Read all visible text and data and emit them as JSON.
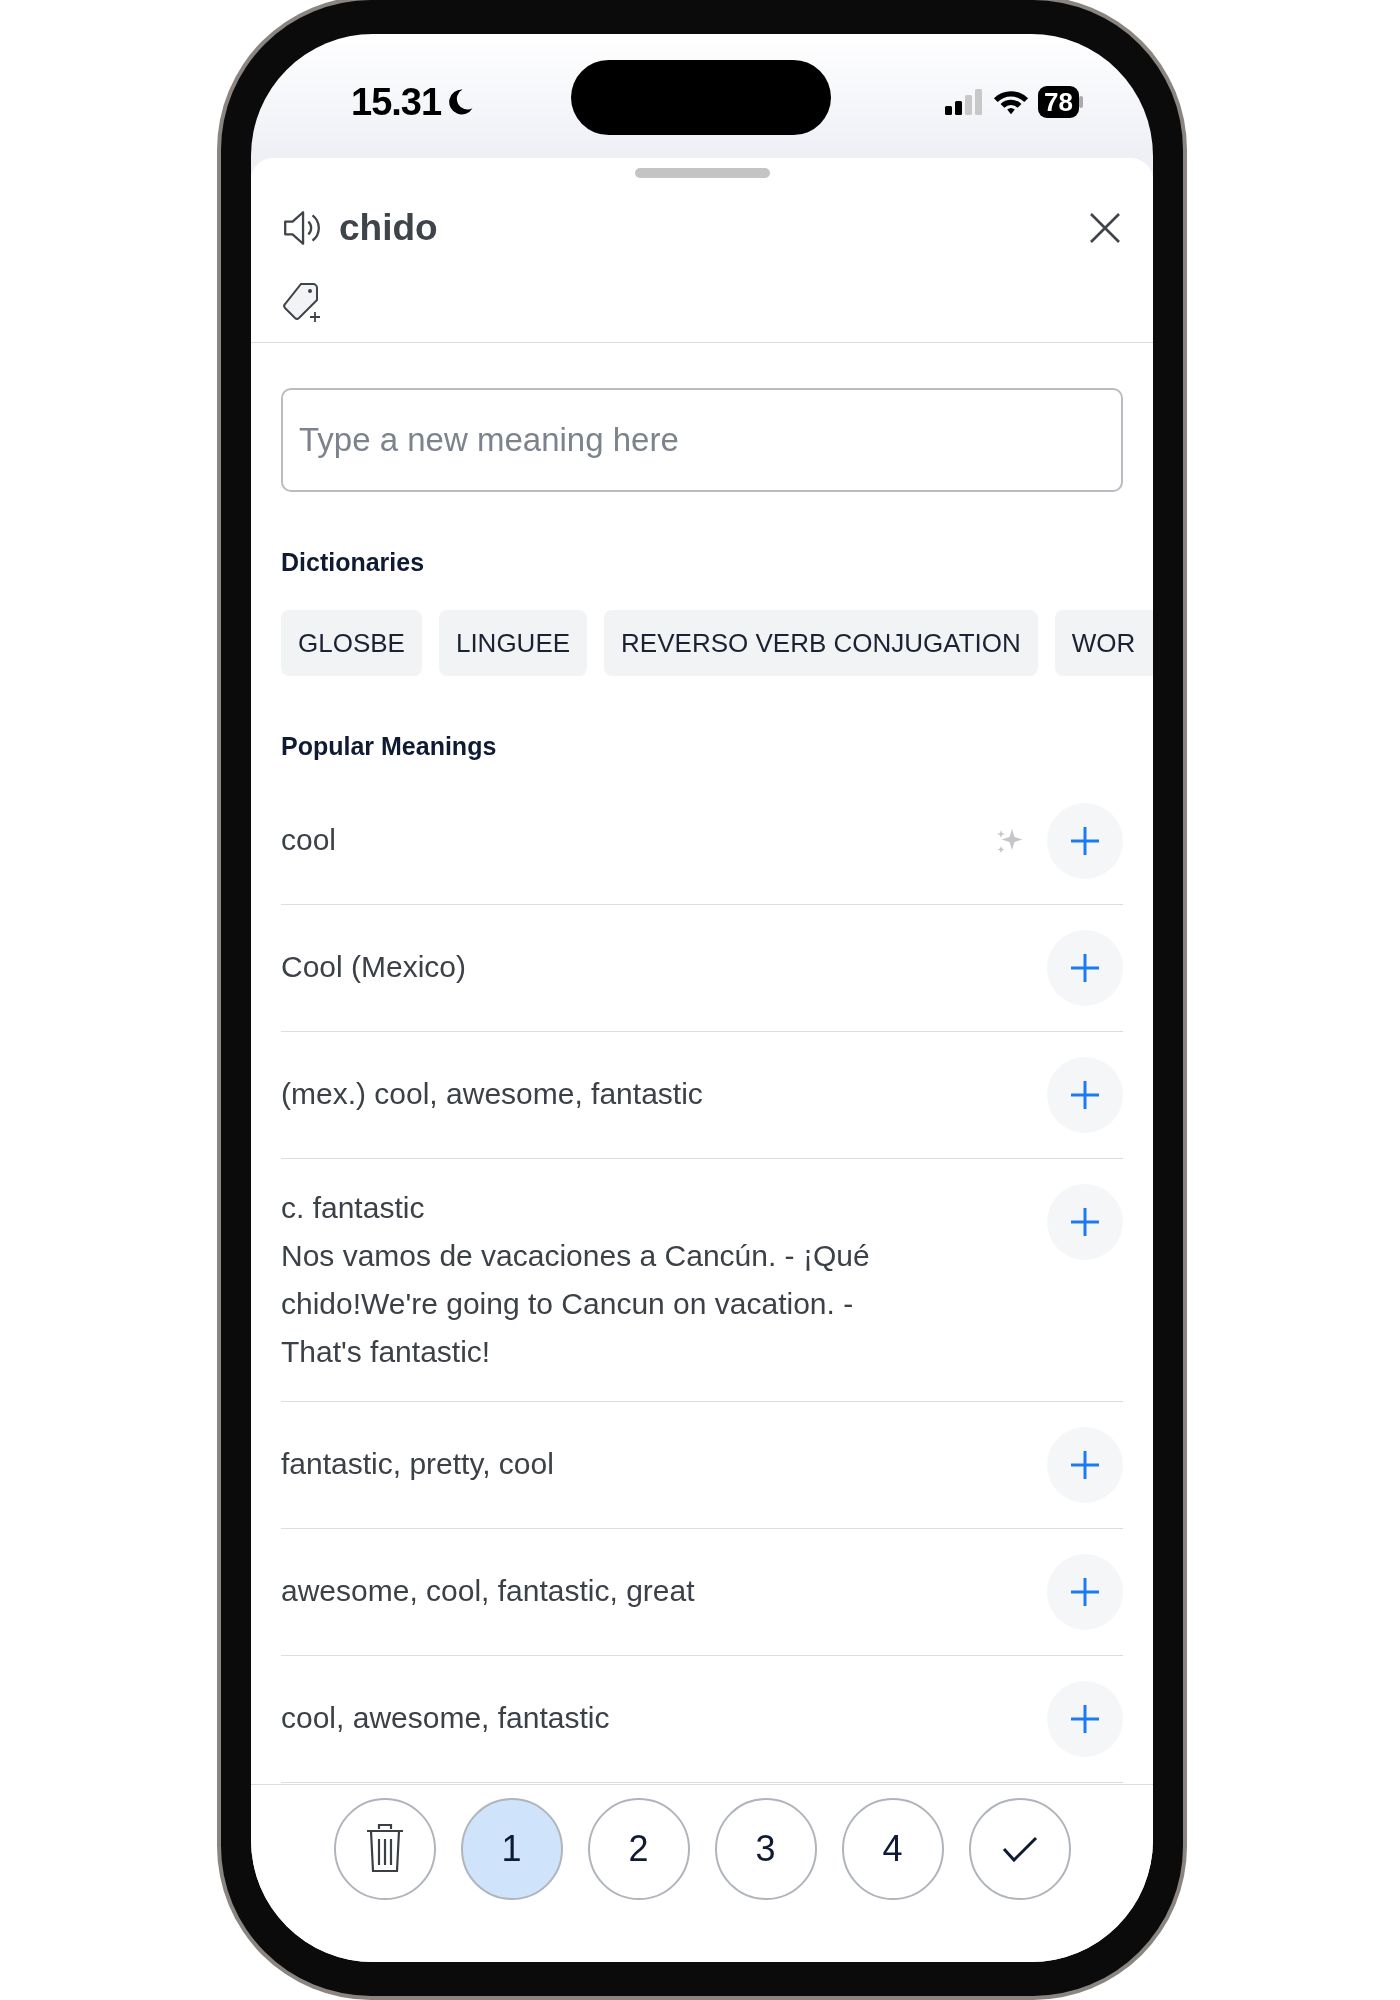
{
  "status_bar": {
    "time": "15.31",
    "battery": "78"
  },
  "sheet": {
    "word": "chido",
    "meaning_input": {
      "placeholder": "Type a new meaning here"
    },
    "dictionaries": {
      "heading": "Dictionaries",
      "items": [
        "GLOSBE",
        "LINGUEE",
        "REVERSO VERB CONJUGATION",
        "WOR"
      ]
    },
    "popular_meanings": {
      "heading": "Popular Meanings",
      "items": [
        {
          "text": "cool",
          "ai_suggested": true
        },
        {
          "text": "Cool (Mexico)",
          "ai_suggested": false
        },
        {
          "text": "(mex.) cool, awesome, fantastic",
          "ai_suggested": false
        },
        {
          "text": "c. fantastic",
          "example": "Nos vamos de vacaciones a Cancún. - ¡Qué chido!We're going to Cancun on vacation. - That's fantastic!",
          "ai_suggested": false
        },
        {
          "text": "fantastic, pretty, cool",
          "ai_suggested": false
        },
        {
          "text": "awesome, cool, fantastic, great",
          "ai_suggested": false
        },
        {
          "text": "cool, awesome, fantastic",
          "ai_suggested": false
        }
      ]
    },
    "rating_bar": {
      "buttons": [
        {
          "kind": "delete",
          "selected": false
        },
        {
          "kind": "number",
          "label": "1",
          "selected": true
        },
        {
          "kind": "number",
          "label": "2",
          "selected": false
        },
        {
          "kind": "number",
          "label": "3",
          "selected": false
        },
        {
          "kind": "number",
          "label": "4",
          "selected": false
        },
        {
          "kind": "confirm",
          "selected": false
        }
      ]
    }
  }
}
